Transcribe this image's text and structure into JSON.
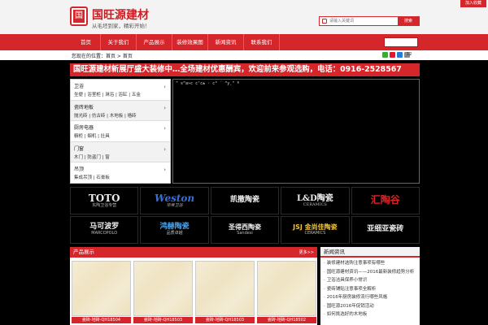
{
  "header": {
    "logo_char": "国",
    "brand": "国旺源建材",
    "slogan": "从毛坯到家，精彩开始！",
    "favorite": "加入收藏",
    "search_placeholder": "请输入关键词",
    "search_button": "搜索"
  },
  "nav": {
    "items": [
      "首页",
      "关于我们",
      "产品展示",
      "装修效果图",
      "新闻资讯",
      "联系我们"
    ]
  },
  "breadcrumb": "您现在的位置：首页 > 首页",
  "share_count": "12",
  "promo": "国旺源建材新展厅盛大装修中…全场建材优惠酬宾，欢迎前来参观选购，电话：0916-2528567",
  "categories": [
    {
      "title": "卫浴",
      "subs": "坐便 | 浴室柜 | 淋浴 | 浴缸 | 五金"
    },
    {
      "title": "瓷砖地板",
      "subs": "抛光砖 | 仿古砖 | 木地板 | 墙砖"
    },
    {
      "title": "厨房电器",
      "subs": "橱柜 | 烟机 | 灶具"
    },
    {
      "title": "门窗",
      "subs": "木门 | 防盗门 | 窗"
    },
    {
      "title": "吊顶",
      "subs": "集成吊顶 | 石膏板"
    }
  ],
  "main_panel_text": "\" s“a»c c’c± · c³ ´ “y¸\" º",
  "brands": [
    {
      "name": "TOTO",
      "sub": "东陶卫浴专营"
    },
    {
      "name": "Weston",
      "sub": "华帝卫浴"
    },
    {
      "name": "凯撒陶瓷",
      "sub": ""
    },
    {
      "name": "L&D陶瓷",
      "sub": "CERAMICS"
    },
    {
      "name": "汇陶谷",
      "sub": ""
    },
    {
      "name": "马可波罗",
      "sub": "MARCOPOLO"
    },
    {
      "name": "鸿赫陶瓷",
      "sub": "品质卓越"
    },
    {
      "name": "圣得西陶瓷",
      "sub": "Sandesi"
    },
    {
      "name": "JSJ 金尚佳陶瓷",
      "sub": "CERAMICS"
    },
    {
      "name": "亚细亚瓷砖",
      "sub": ""
    }
  ],
  "products": {
    "title": "产品展示",
    "more": "更多>>",
    "items": [
      {
        "caption": "瓷砖-地砖-QH18504"
      },
      {
        "caption": "瓷砖-地砖-QH18503"
      },
      {
        "caption": "瓷砖-地砖-QH18503"
      },
      {
        "caption": "瓷砖-地砖-QH18502"
      }
    ]
  },
  "news": {
    "title": "新闻资讯",
    "items": [
      "装修建材选购注意事项有哪些",
      "国旺源建材资讯——2016最新装修趋势分析",
      "卫浴洁具保养小常识",
      "瓷砖铺贴注意事项全解析",
      "2016年厨房装修流行哪些风格",
      "国旺源2016年促销活动",
      "如何挑选好的木地板"
    ]
  },
  "colors": {
    "accent": "#d5262b",
    "header_bg": "#f3f3f3",
    "page_bg": "#000000"
  }
}
